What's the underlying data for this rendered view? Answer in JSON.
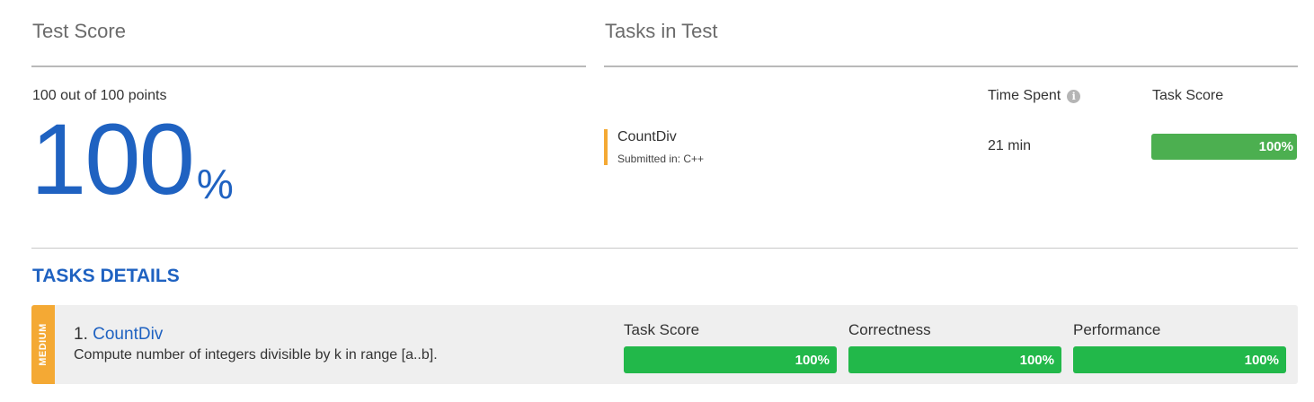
{
  "test_score": {
    "title": "Test Score",
    "points_label": "100 out of 100 points",
    "percent_value": "100",
    "percent_sign": "%"
  },
  "tasks_in_test": {
    "title": "Tasks in Test",
    "columns": {
      "time_spent": "Time Spent",
      "info_icon": "info-icon",
      "task_score": "Task Score"
    },
    "tasks": [
      {
        "name": "CountDiv",
        "submitted": "Submitted in: C++",
        "time_spent": "21 min",
        "score_label": "100%",
        "score_fraction": 1.0
      }
    ]
  },
  "details": {
    "title": "TASKS DETAILS",
    "items": [
      {
        "difficulty": "MEDIUM",
        "number": "1.",
        "name": "CountDiv",
        "description": "Compute number of integers divisible by k in range [a..b].",
        "metrics": [
          {
            "label": "Task Score",
            "value_label": "100%",
            "fraction": 1.0
          },
          {
            "label": "Correctness",
            "value_label": "100%",
            "fraction": 1.0
          },
          {
            "label": "Performance",
            "value_label": "100%",
            "fraction": 1.0
          }
        ]
      }
    ]
  },
  "colors": {
    "accent_blue": "#1f62c1",
    "medium_orange": "#f4a934",
    "score_green": "#4caf50",
    "metric_green": "#22b84a"
  }
}
